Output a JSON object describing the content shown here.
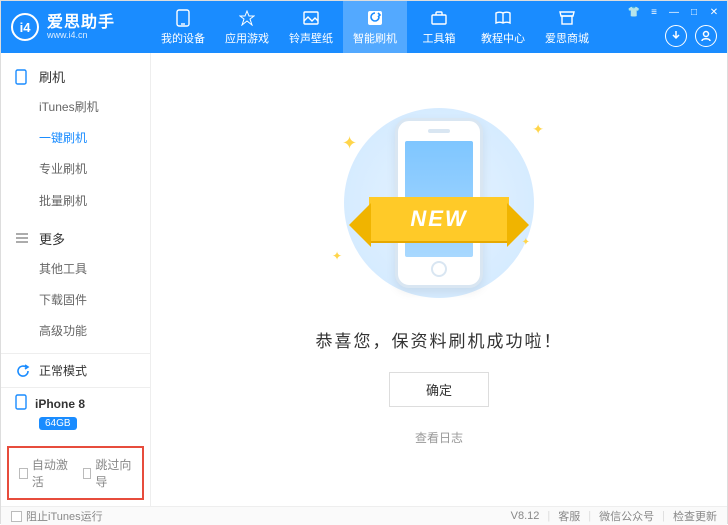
{
  "app": {
    "name": "爱思助手",
    "url": "www.i4.cn"
  },
  "nav": {
    "items": [
      {
        "label": "我的设备"
      },
      {
        "label": "应用游戏"
      },
      {
        "label": "铃声壁纸"
      },
      {
        "label": "智能刷机"
      },
      {
        "label": "工具箱"
      },
      {
        "label": "教程中心"
      },
      {
        "label": "爱思商城"
      }
    ],
    "active_index": 3
  },
  "sidebar": {
    "groups": [
      {
        "title": "刷机",
        "items": [
          "iTunes刷机",
          "一键刷机",
          "专业刷机",
          "批量刷机"
        ],
        "active_index": 1
      },
      {
        "title": "更多",
        "items": [
          "其他工具",
          "下载固件",
          "高级功能"
        ],
        "active_index": -1
      }
    ],
    "mode": "正常模式",
    "device": {
      "name": "iPhone 8",
      "storage": "64GB"
    },
    "checkboxes": {
      "auto_activate": "自动激活",
      "skip_guide": "跳过向导"
    }
  },
  "main": {
    "ribbon": "NEW",
    "success": "恭喜您，保资料刷机成功啦！",
    "ok": "确定",
    "log": "查看日志"
  },
  "footer": {
    "block_itunes": "阻止iTunes运行",
    "version": "V8.12",
    "links": [
      "客服",
      "微信公众号",
      "检查更新"
    ]
  }
}
